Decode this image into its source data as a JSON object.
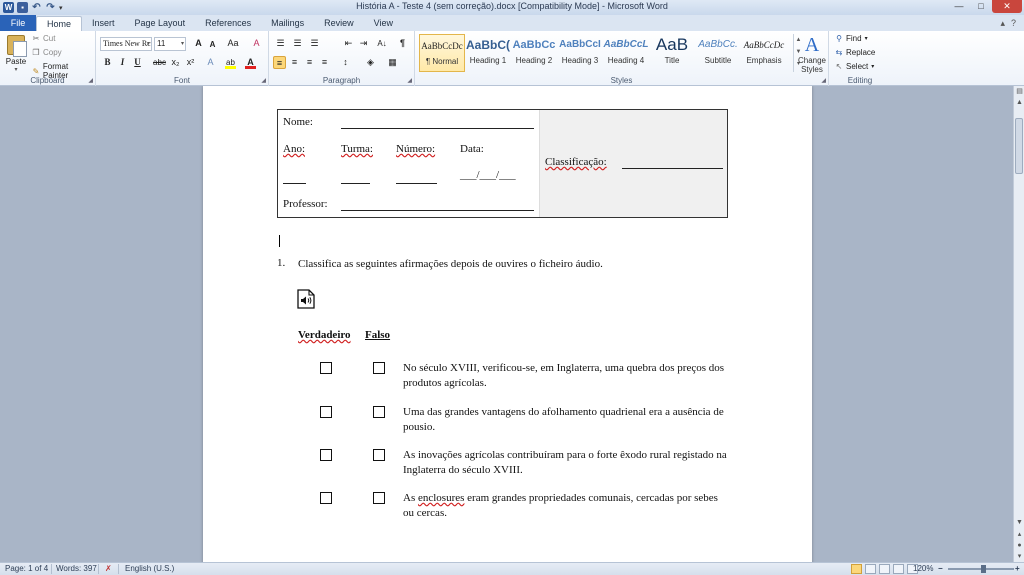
{
  "window": {
    "title": "História A - Teste 4 (sem correção).docx [Compatibility Mode] - Microsoft Word",
    "minimize": "—",
    "maximize": "□",
    "close": "✕",
    "help": "?"
  },
  "qat": {
    "word": "W",
    "save": "▪",
    "undo": "↶",
    "redo": "↷",
    "more": "▾"
  },
  "tabs": {
    "file": "File",
    "items": [
      "Home",
      "Insert",
      "Page Layout",
      "References",
      "Mailings",
      "Review",
      "View"
    ],
    "active": "Home"
  },
  "clipboard": {
    "paste": "Paste",
    "cut": "Cut",
    "copy": "Copy",
    "format_painter": "Format Painter",
    "label": "Clipboard"
  },
  "font": {
    "name": "Times New Rc",
    "size": "11",
    "grow": "A",
    "shrink": "A",
    "case": "Aa",
    "clear": "A",
    "bold": "B",
    "italic": "I",
    "underline": "U",
    "strike": "abc",
    "subscript": "x₂",
    "superscript": "x²",
    "effects": "A",
    "highlight": "ab",
    "color": "A",
    "label": "Font",
    "highlight_color": "#ffff00",
    "font_color": "#e02020"
  },
  "paragraph": {
    "bullets": "☰",
    "numbering": "☰",
    "multilevel": "☰",
    "decrease_indent": "⇤",
    "increase_indent": "⇥",
    "sort": "A↓",
    "show_marks": "¶",
    "align_left": "≡",
    "center": "≡",
    "align_right": "≡",
    "justify": "≡",
    "line_spacing": "↕",
    "shading": "◈",
    "borders": "▦",
    "label": "Paragraph"
  },
  "styles": {
    "items": [
      {
        "sample": "AaBbCcDc",
        "name": "¶ Normal"
      },
      {
        "sample": "AaBbC(",
        "name": "Heading 1"
      },
      {
        "sample": "AaBbCc",
        "name": "Heading 2"
      },
      {
        "sample": "AaBbCcI",
        "name": "Heading 3"
      },
      {
        "sample": "AaBbCcL",
        "name": "Heading 4"
      },
      {
        "sample": "AaB",
        "name": "Title"
      },
      {
        "sample": "AaBbCc.",
        "name": "Subtitle"
      },
      {
        "sample": "AaBbCcDc",
        "name": "Emphasis"
      }
    ],
    "change_styles": "Change Styles",
    "change_icon": "A",
    "label": "Styles"
  },
  "editing": {
    "find": "Find",
    "replace": "Replace",
    "select": "Select",
    "label": "Editing"
  },
  "document": {
    "header": {
      "nome": "Nome:",
      "ano": "Ano:",
      "turma": "Turma:",
      "numero": "Número:",
      "data": "Data:",
      "data_blank": "___/___/___",
      "professor": "Professor:",
      "classificacao": "Classificação:"
    },
    "question_number": "1.",
    "question_text": "Classifica as seguintes afirmações depois de ouvires o ficheiro áudio.",
    "col_true": "Verdadeiro",
    "col_false": "Falso",
    "statements": [
      {
        "line1": "No século XVIII, verificou-se, em Inglaterra, uma quebra dos preços dos",
        "line2": "produtos agrícolas."
      },
      {
        "line1": "Uma das grandes vantagens do afolhamento quadrienal era a ausência de",
        "line2": "pousio."
      },
      {
        "line1": "As inovações agrícolas contribuíram para o forte êxodo rural registado na",
        "line2": "Inglaterra do século XVIII."
      },
      {
        "line1_pre": "As ",
        "line1_spell": "enclosures",
        "line1_post": " eram grandes propriedades comunais, cercadas por sebes",
        "line2": "ou cercas."
      }
    ]
  },
  "status": {
    "page": "Page: 1 of 4",
    "words": "Words: 397",
    "language": "English (U.S.)",
    "zoom": "120%",
    "zoom_out": "−",
    "zoom_in": "+"
  }
}
